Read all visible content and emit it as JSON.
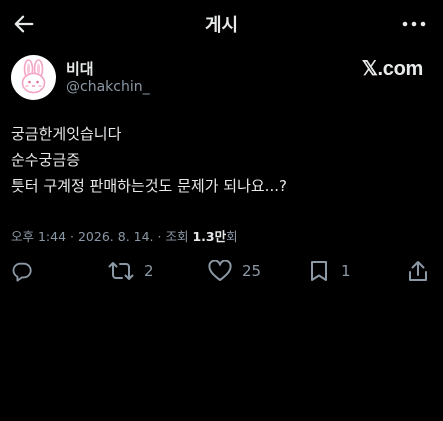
{
  "header": {
    "title": "게시",
    "back_icon": "arrow-left-icon",
    "more_icon": "more-horizontal-icon"
  },
  "author": {
    "display_name": "비대",
    "handle": "@chakchin_",
    "avatar": "pink-bunny-avatar"
  },
  "source_logo": "𝕏.com",
  "tweet": {
    "lines": [
      "궁금한게잇습니다",
      "순수궁금증",
      "틋터 구계정 판매하는것도 문제가 되나요...?"
    ]
  },
  "meta": {
    "time": "오후 1:44",
    "date": "2026. 8. 14.",
    "views_label": "조회",
    "views_count": "1.3만",
    "views_suffix": "회"
  },
  "actions": {
    "reply_icon": "reply-icon",
    "retweet_icon": "retweet-icon",
    "retweet_count": "2",
    "like_icon": "heart-icon",
    "like_count": "25",
    "bookmark_icon": "bookmark-icon",
    "bookmark_count": "1",
    "share_icon": "share-icon"
  },
  "colors": {
    "background": "#000000",
    "text": "#e7e9ea",
    "secondary": "#8b98a5",
    "avatar_pink": "#f4a3c4"
  }
}
